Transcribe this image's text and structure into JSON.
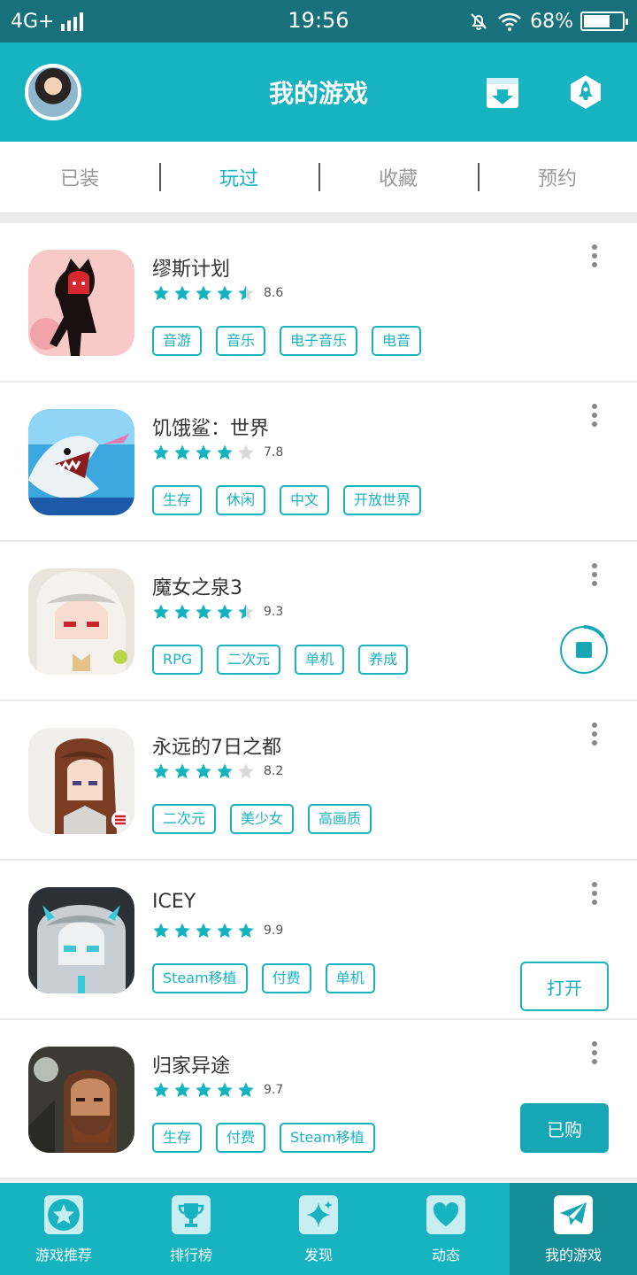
{
  "status_bar": {
    "network": "4G+",
    "time": "19:56",
    "battery": "68%",
    "battery_level": 0.68
  },
  "header": {
    "title": "我的游戏"
  },
  "tabs": [
    {
      "label": "已装",
      "active": false
    },
    {
      "label": "玩过",
      "active": true
    },
    {
      "label": "收藏",
      "active": false
    },
    {
      "label": "预约",
      "active": false
    }
  ],
  "games": [
    {
      "name": "缪斯计划",
      "rating": "8.6",
      "stars": 4.5,
      "tags": [
        "音游",
        "音乐",
        "电子音乐",
        "电音"
      ],
      "action": null
    },
    {
      "name": "饥饿鲨：世界",
      "rating": "7.8",
      "stars": 4,
      "tags": [
        "生存",
        "休闲",
        "中文",
        "开放世界"
      ],
      "action": null
    },
    {
      "name": "魔女之泉3",
      "rating": "9.3",
      "stars": 4.5,
      "tags": [
        "RPG",
        "二次元",
        "单机",
        "养成"
      ],
      "action": "stop"
    },
    {
      "name": "永远的7日之都",
      "rating": "8.2",
      "stars": 4,
      "tags": [
        "二次元",
        "美少女",
        "高画质"
      ],
      "action": null
    },
    {
      "name": "ICEY",
      "rating": "9.9",
      "stars": 5,
      "tags": [
        "Steam移植",
        "付费",
        "单机"
      ],
      "action": "open"
    },
    {
      "name": "归家异途",
      "rating": "9.7",
      "stars": 5,
      "tags": [
        "生存",
        "付费",
        "Steam移植"
      ],
      "action": "bought"
    }
  ],
  "buttons": {
    "open": "打开",
    "bought": "已购"
  },
  "bottom_nav": [
    {
      "label": "游戏推荐",
      "icon": "star-icon",
      "active": false
    },
    {
      "label": "排行榜",
      "icon": "trophy-icon",
      "active": false
    },
    {
      "label": "发现",
      "icon": "sparkle-icon",
      "active": false
    },
    {
      "label": "动态",
      "icon": "heart-icon",
      "active": false
    },
    {
      "label": "我的游戏",
      "icon": "paper-plane-icon",
      "active": true
    }
  ],
  "colors": {
    "accent": "#17b3c0",
    "status_bar": "#17707a",
    "nav_active": "#168e99",
    "star_empty": "#d9d9d9"
  }
}
